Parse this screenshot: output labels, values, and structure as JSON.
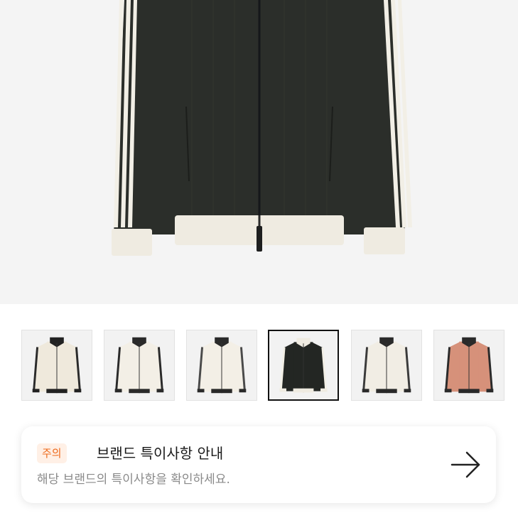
{
  "product": {
    "main_image": {
      "alt": "product-main-image",
      "body_color": "#2b2e2a",
      "stripe_color": "#f2efe6",
      "trim_color": "#efebe1"
    },
    "thumbnails": [
      {
        "body": "#efe9dc",
        "stripe": "#2a2a2a",
        "trim": "#222222",
        "selected": false
      },
      {
        "body": "#f3efe6",
        "stripe": "#2a2a2a",
        "trim": "#2a2a2a",
        "selected": false
      },
      {
        "body": "#f3efe6",
        "stripe": "#4a4a4a",
        "trim": "#2a2a2a",
        "selected": false
      },
      {
        "body": "#232623",
        "stripe": "#f2efe6",
        "trim": "#efebe1",
        "selected": true
      },
      {
        "body": "#f1ede4",
        "stripe": "#3a3a3a",
        "trim": "#2a2a2a",
        "selected": false
      },
      {
        "body": "#d6917a",
        "stripe": "#2a2a2a",
        "trim": "#2a2a2a",
        "selected": false
      }
    ]
  },
  "notice": {
    "badge": "주의",
    "title": "브랜드 특이사항 안내",
    "description": "해당 브랜드의 특이사항을 확인하세요.",
    "arrow_icon": "arrow-right-icon"
  },
  "colors": {
    "accent_orange": "#ee6a1c",
    "badge_bg": "#fff0e6"
  }
}
